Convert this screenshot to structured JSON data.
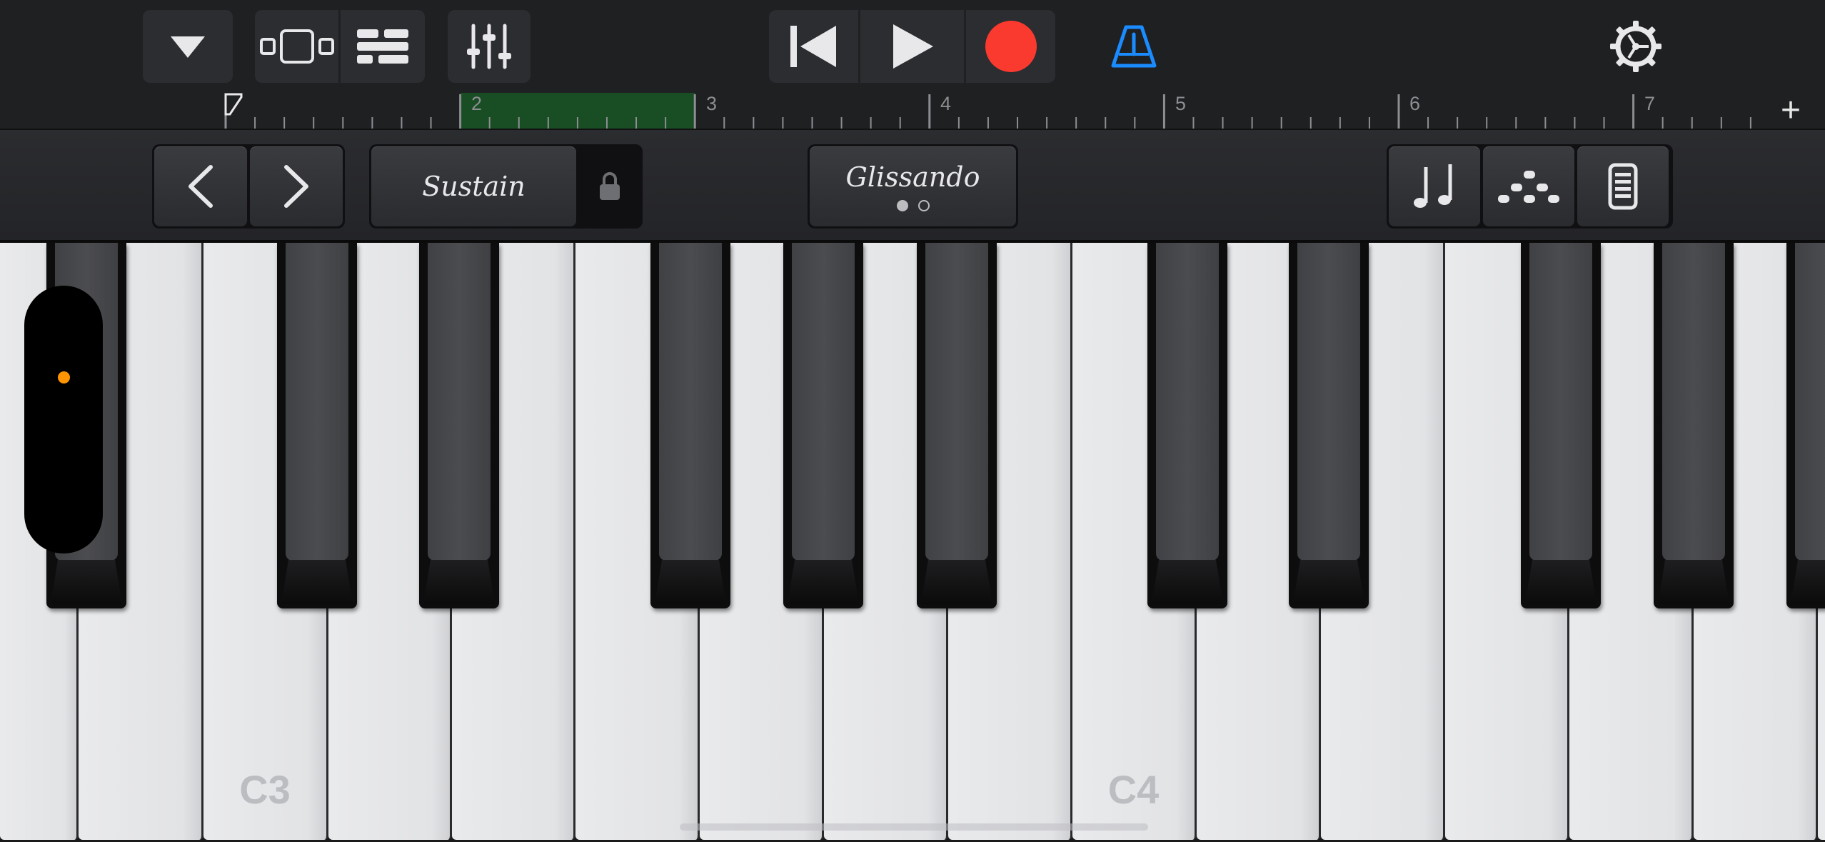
{
  "toolbar": {
    "icons": [
      "browser-dropdown-icon",
      "tracks-view-icon",
      "track-list-icon",
      "mixer-icon",
      "go-to-beginning-icon",
      "play-icon",
      "record-icon",
      "metronome-icon",
      "settings-gear-icon"
    ],
    "colors": {
      "record": "#fb3a2f",
      "metronome": "#1a8cff",
      "icon": "#e8e8ea"
    }
  },
  "ruler": {
    "bar_numbers": [
      "2",
      "3",
      "4",
      "5",
      "6",
      "7"
    ],
    "add_label": "+",
    "loop_region_color": "#194d24"
  },
  "controls": {
    "sustain_label": "Sustain",
    "glissando_label": "Glissando",
    "glissando_page": 1,
    "glissando_pages": 2,
    "icons": [
      "octave-down-chevron-icon",
      "octave-up-chevron-icon",
      "sustain-lock-icon",
      "notes-icon",
      "arpeggiator-icon",
      "keyboard-settings-icon"
    ]
  },
  "keyboard": {
    "c3_label": "C3",
    "c4_label": "C4",
    "range_indicator_color": "#ff9500"
  }
}
